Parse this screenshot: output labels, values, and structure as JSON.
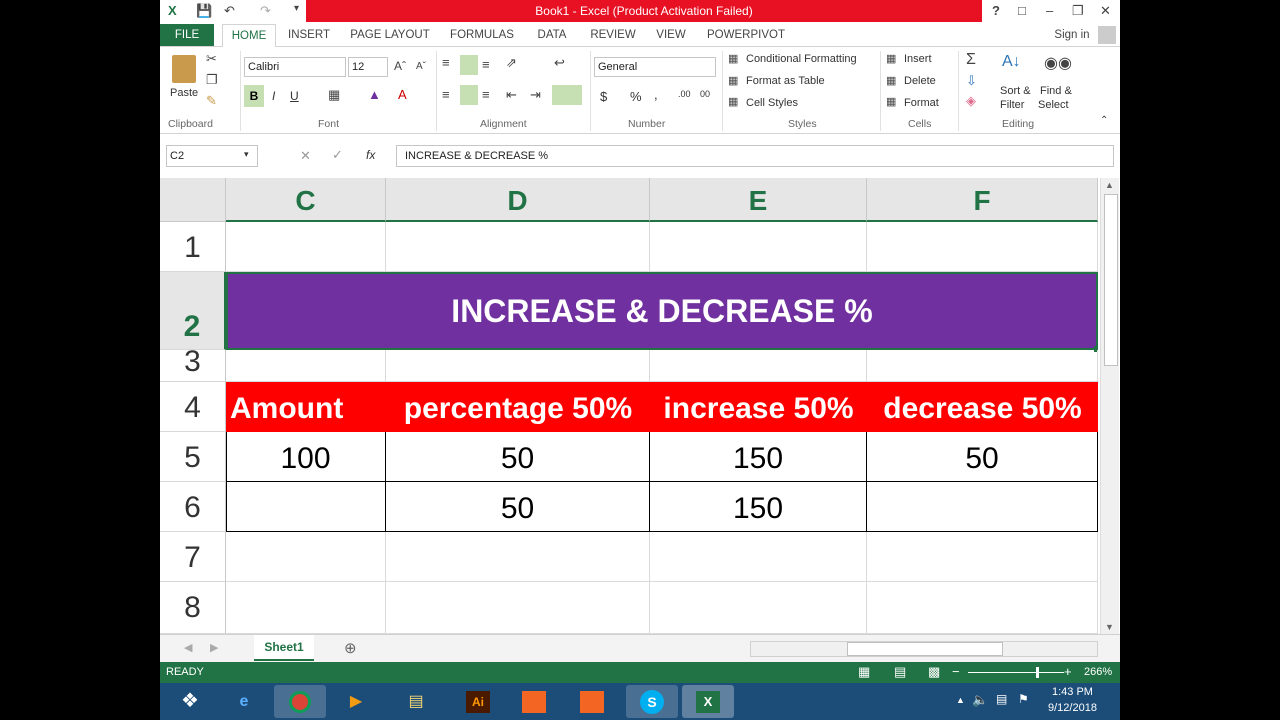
{
  "title_bar": {
    "title": "Book1 -  Excel (Product Activation Failed)",
    "help": "?",
    "restore_icon": "restore-icon",
    "minimize": "–",
    "maximize": "❐",
    "close": "✕"
  },
  "tabs": [
    "FILE",
    "HOME",
    "INSERT",
    "PAGE LAYOUT",
    "FORMULAS",
    "DATA",
    "REVIEW",
    "VIEW",
    "POWERPIVOT"
  ],
  "sign_in": "Sign in",
  "ribbon": {
    "clipboard": {
      "label": "Clipboard",
      "paste": "Paste"
    },
    "font": {
      "label": "Font",
      "name": "Calibri",
      "size": "12",
      "bold": "B",
      "italic": "I",
      "underline": "U"
    },
    "alignment": {
      "label": "Alignment"
    },
    "number": {
      "label": "Number",
      "format": "General",
      "currency": "$",
      "percent": "%",
      "comma": ",",
      "inc": ".00",
      "dec": "00"
    },
    "styles": {
      "label": "Styles",
      "conditional": "Conditional Formatting",
      "format_table": "Format as Table",
      "cell_styles": "Cell Styles"
    },
    "cells": {
      "label": "Cells",
      "insert": "Insert",
      "delete": "Delete",
      "format": "Format"
    },
    "editing": {
      "label": "Editing",
      "sort_filter": "Sort &",
      "sort_filter2": "Filter",
      "find": "Find &",
      "find2": "Select"
    }
  },
  "formula_bar": {
    "name_box": "C2",
    "fx": "fx",
    "content": "INCREASE & DECREASE %"
  },
  "columns": [
    "C",
    "D",
    "E",
    "F"
  ],
  "rows": [
    "1",
    "2",
    "3",
    "4",
    "5",
    "6",
    "7",
    "8"
  ],
  "title_cell": "INCREASE & DECREASE %",
  "header_row": [
    "Amount",
    "percentage 50%",
    "increase 50%",
    "decrease 50%"
  ],
  "row5": [
    "100",
    "50",
    "150",
    "50"
  ],
  "row6": [
    "",
    "50",
    "150",
    ""
  ],
  "sheet_tab": "Sheet1",
  "status": {
    "ready": "READY",
    "zoom": "266%"
  },
  "clock": {
    "time": "1:43 PM",
    "date": "9/12/2018"
  },
  "colors": {
    "excel_green": "#217346",
    "title_fill": "#7030a0",
    "header_fill": "#ff0000",
    "title_bar_red": "#e81123"
  }
}
